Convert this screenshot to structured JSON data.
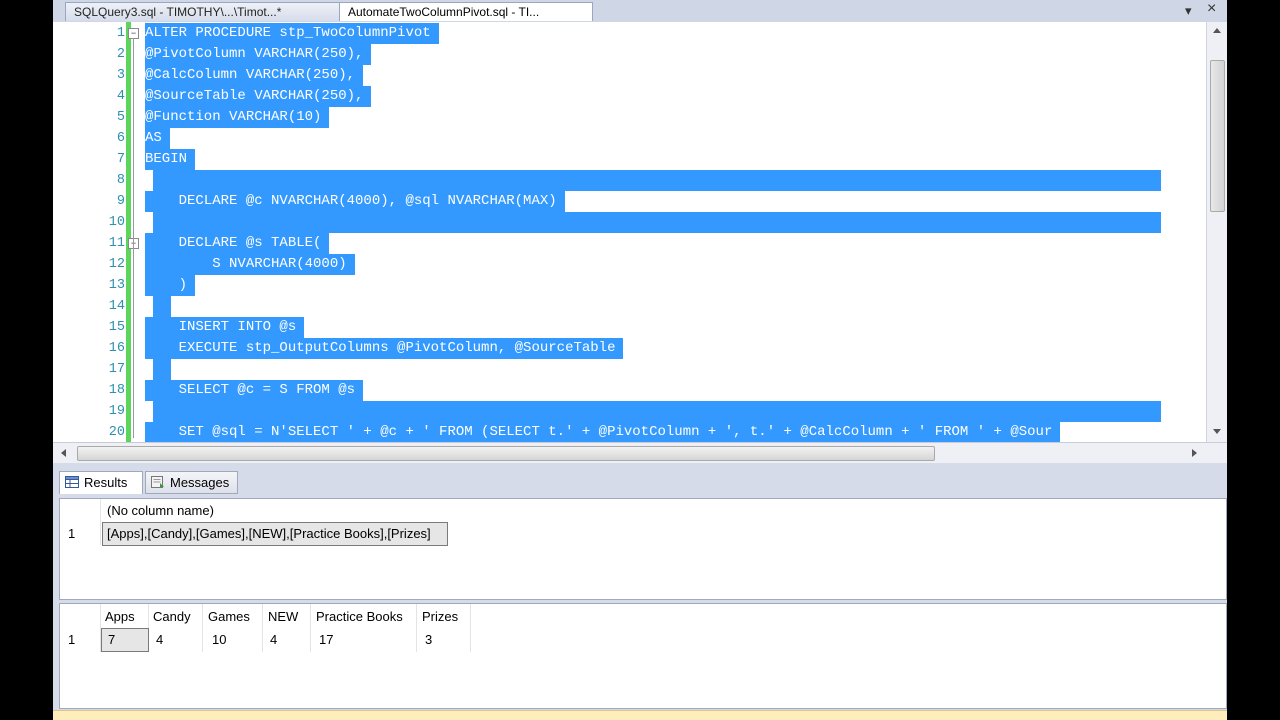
{
  "tabs": [
    {
      "label": "SQLQuery3.sql - TIMOTHY\\...\\Timot...*",
      "close": ""
    },
    {
      "label": "AutomateTwoColumnPivot.sql - TI...",
      "close": "×"
    }
  ],
  "tab_controls": {
    "dropdown": "▾",
    "close": "×"
  },
  "editor": {
    "line_numbers": [
      "1",
      "2",
      "3",
      "4",
      "5",
      "6",
      "7",
      "8",
      "9",
      "10",
      "11",
      "12",
      "13",
      "14",
      "15",
      "16",
      "17",
      "18",
      "19",
      "20"
    ],
    "lines": [
      "ALTER PROCEDURE stp_TwoColumnPivot",
      "@PivotColumn VARCHAR(250),",
      "@CalcColumn VARCHAR(250),",
      "@SourceTable VARCHAR(250),",
      "@Function VARCHAR(10)",
      "AS",
      "BEGIN",
      "",
      "    DECLARE @c NVARCHAR(4000), @sql NVARCHAR(MAX)",
      "",
      "    DECLARE @s TABLE(",
      "        S NVARCHAR(4000)",
      "    )",
      "",
      "    INSERT INTO @s",
      "    EXECUTE stp_OutputColumns @PivotColumn, @SourceTable",
      "",
      "    SELECT @c = S FROM @s",
      "",
      "    SET @sql = N'SELECT ' + @c + ' FROM (SELECT t.' + @PivotColumn + ', t.' + @CalcColumn + ' FROM ' + @Sour"
    ],
    "selection_color": "#3399ff",
    "change_bar_color": "#5bd55b",
    "line_number_color": "#2b91af"
  },
  "results_tabs": {
    "results": "Results",
    "messages": "Messages"
  },
  "result1": {
    "header": "(No column name)",
    "row_number": "1",
    "value": "[Apps],[Candy],[Games],[NEW],[Practice Books],[Prizes]"
  },
  "result2": {
    "headers": [
      "Apps",
      "Candy",
      "Games",
      "NEW",
      "Practice Books",
      "Prizes"
    ],
    "row_number": "1",
    "values": [
      "7",
      "4",
      "10",
      "4",
      "17",
      "3"
    ]
  }
}
